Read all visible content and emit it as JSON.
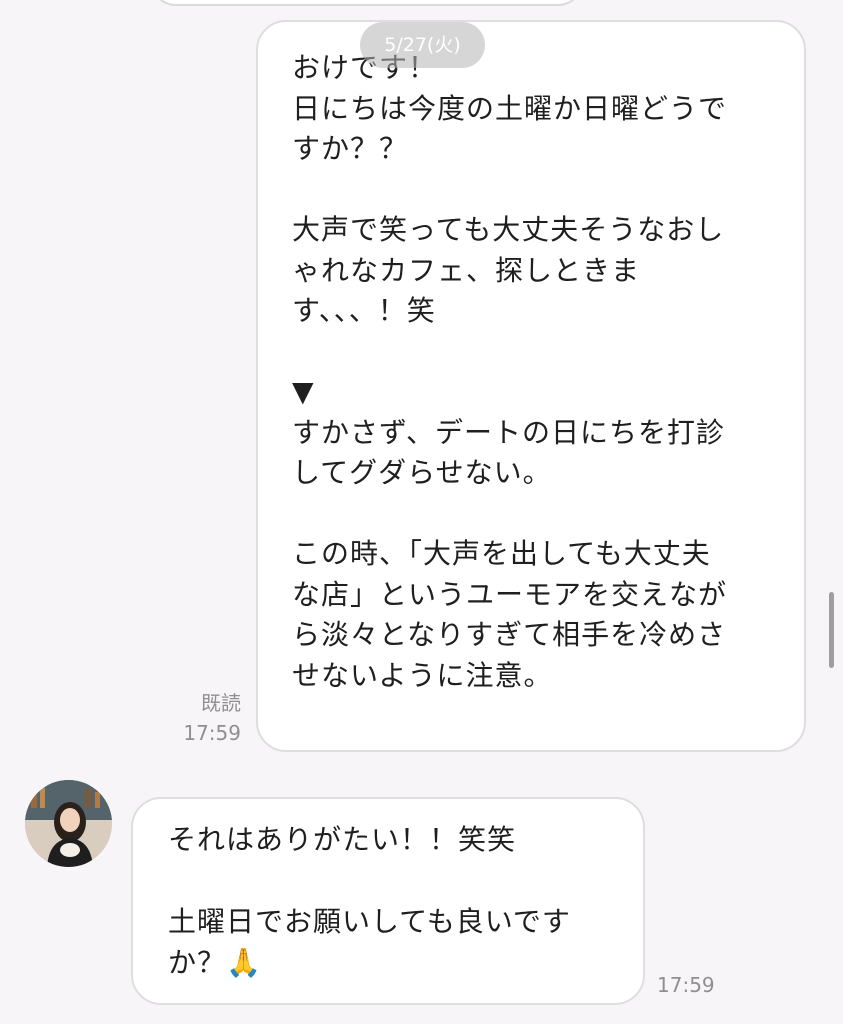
{
  "chat": {
    "date_pill": "5/27(火)",
    "outgoing": {
      "text": "おけです！\n日にちは今度の土曜か日曜どうで\nすか？？\n\n大声で笑っても大丈夫そうなおし\nゃれなカフェ、探しときま\nす、、、！笑\n\n▼\nすかさず、デートの日にちを打診\nしてグダらせない。\n\nこの時、「大声を出しても大丈夫\nな店」というユーモアを交えなが\nら淡々となりすぎて相手を冷めさ\nせないように注意。",
      "read_label": "既読",
      "time": "17:59"
    },
    "incoming": {
      "text": "それはありがたい！！笑笑\n\n土曜日でお願いしても良いです\nか？🙏",
      "time": "17:59",
      "avatar_icon": "profile-avatar"
    }
  }
}
